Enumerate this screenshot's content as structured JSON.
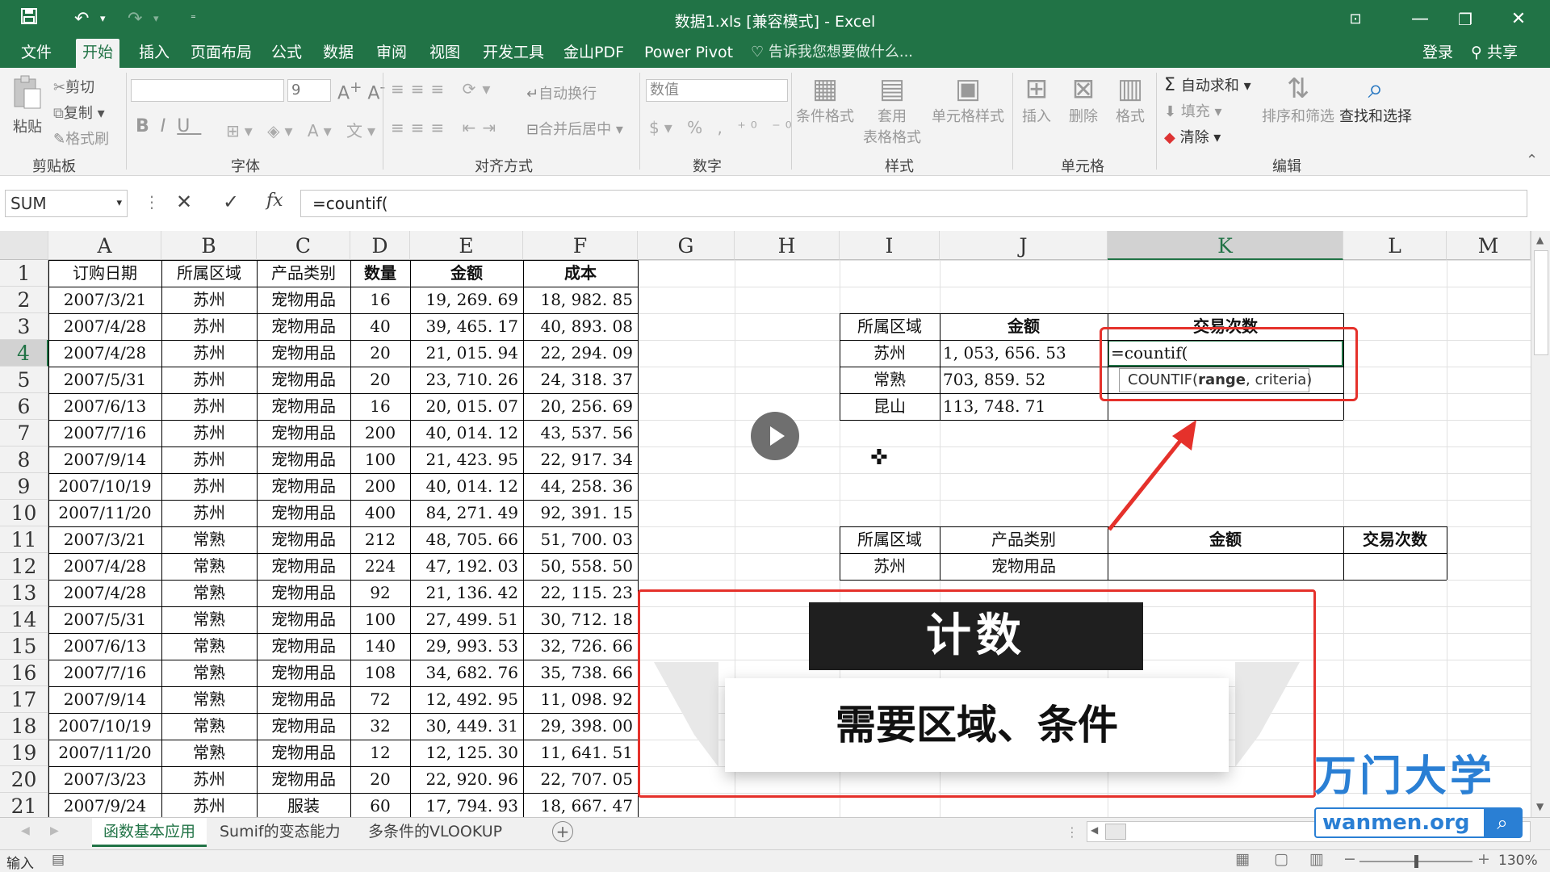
{
  "window": {
    "title": "数据1.xls  [兼容模式] - Excel",
    "quick_access": [
      "save-icon",
      "undo-icon",
      "redo-icon",
      "customize-icon"
    ],
    "controls": [
      "ribbon-display-icon",
      "minimize-icon",
      "restore-icon",
      "close-icon"
    ],
    "accent": "#217346"
  },
  "menu": {
    "tabs": [
      "文件",
      "开始",
      "插入",
      "页面布局",
      "公式",
      "数据",
      "审阅",
      "视图",
      "开发工具",
      "金山PDF",
      "Power Pivot"
    ],
    "active_tab": "开始",
    "tell_me": "告诉我您想要做什么...",
    "login": "登录",
    "share": "共享"
  },
  "ribbon": {
    "clipboard": {
      "paste": "粘贴",
      "cut": "剪切",
      "copy": "复制",
      "format_painter": "格式刷",
      "label": "剪贴板"
    },
    "font": {
      "font_size": "9",
      "label": "字体"
    },
    "alignment": {
      "wrap": "自动换行",
      "merge": "合并后居中",
      "label": "对齐方式"
    },
    "number": {
      "format": "数值",
      "label": "数字"
    },
    "styles": {
      "conditional": "条件格式",
      "table_line1": "套用",
      "table_line2": "表格格式",
      "cell_styles": "单元格样式",
      "label": "样式"
    },
    "cells": {
      "insert": "插入",
      "delete": "删除",
      "format": "格式",
      "label": "单元格"
    },
    "editing": {
      "autosum": "自动求和",
      "fill": "填充",
      "clear": "清除",
      "sort": "排序和筛选",
      "find": "查找和选择",
      "label": "编辑"
    }
  },
  "formula_bar": {
    "name_box": "SUM",
    "formula": "=countif("
  },
  "grid": {
    "columns": [
      "A",
      "B",
      "C",
      "D",
      "E",
      "F",
      "G",
      "H",
      "I",
      "J",
      "K",
      "L",
      "M"
    ],
    "selected_column": "K",
    "selected_row": "4",
    "rows": [
      "1",
      "2",
      "3",
      "4",
      "5",
      "6",
      "7",
      "8",
      "9",
      "10",
      "11",
      "12",
      "13",
      "14",
      "15",
      "16",
      "17",
      "18",
      "19",
      "20",
      "21"
    ]
  },
  "table_main": {
    "headers": [
      "订购日期",
      "所属区域",
      "产品类别",
      "数量",
      "金额",
      "成本"
    ],
    "rows": [
      [
        "2007/3/21",
        "苏州",
        "宠物用品",
        "16",
        "19, 269. 69",
        "18, 982. 85"
      ],
      [
        "2007/4/28",
        "苏州",
        "宠物用品",
        "40",
        "39, 465. 17",
        "40, 893. 08"
      ],
      [
        "2007/4/28",
        "苏州",
        "宠物用品",
        "20",
        "21, 015. 94",
        "22, 294. 09"
      ],
      [
        "2007/5/31",
        "苏州",
        "宠物用品",
        "20",
        "23, 710. 26",
        "24, 318. 37"
      ],
      [
        "2007/6/13",
        "苏州",
        "宠物用品",
        "16",
        "20, 015. 07",
        "20, 256. 69"
      ],
      [
        "2007/7/16",
        "苏州",
        "宠物用品",
        "200",
        "40, 014. 12",
        "43, 537. 56"
      ],
      [
        "2007/9/14",
        "苏州",
        "宠物用品",
        "100",
        "21, 423. 95",
        "22, 917. 34"
      ],
      [
        "2007/10/19",
        "苏州",
        "宠物用品",
        "200",
        "40, 014. 12",
        "44, 258. 36"
      ],
      [
        "2007/11/20",
        "苏州",
        "宠物用品",
        "400",
        "84, 271. 49",
        "92, 391. 15"
      ],
      [
        "2007/3/21",
        "常熟",
        "宠物用品",
        "212",
        "48, 705. 66",
        "51, 700. 03"
      ],
      [
        "2007/4/28",
        "常熟",
        "宠物用品",
        "224",
        "47, 192. 03",
        "50, 558. 50"
      ],
      [
        "2007/4/28",
        "常熟",
        "宠物用品",
        "92",
        "21, 136. 42",
        "22, 115. 23"
      ],
      [
        "2007/5/31",
        "常熟",
        "宠物用品",
        "100",
        "27, 499. 51",
        "30, 712. 18"
      ],
      [
        "2007/6/13",
        "常熟",
        "宠物用品",
        "140",
        "29, 993. 53",
        "32, 726. 66"
      ],
      [
        "2007/7/16",
        "常熟",
        "宠物用品",
        "108",
        "34, 682. 76",
        "35, 738. 66"
      ],
      [
        "2007/9/14",
        "常熟",
        "宠物用品",
        "72",
        "12, 492. 95",
        "11, 098. 92"
      ],
      [
        "2007/10/19",
        "常熟",
        "宠物用品",
        "32",
        "30, 449. 31",
        "29, 398. 00"
      ],
      [
        "2007/11/20",
        "常熟",
        "宠物用品",
        "12",
        "12, 125. 30",
        "11, 641. 51"
      ],
      [
        "2007/3/23",
        "苏州",
        "宠物用品",
        "20",
        "22, 920. 96",
        "22, 707. 05"
      ],
      [
        "2007/9/24",
        "苏州",
        "服装",
        "60",
        "17, 794. 93",
        "18, 667. 47"
      ]
    ]
  },
  "summary1": {
    "headers": [
      "所属区域",
      "金额",
      "交易次数"
    ],
    "rows": [
      [
        "苏州",
        "1, 053, 656. 53",
        "=countif("
      ],
      [
        "常熟",
        "703, 859. 52",
        ""
      ],
      [
        "昆山",
        "113, 748. 71",
        ""
      ]
    ],
    "autocomplete": {
      "fn": "COUNTIF(",
      "arg1": "range",
      "rest": ", criteria)"
    }
  },
  "summary2": {
    "headers": [
      "所属区域",
      "产品类别",
      "金额",
      "交易次数"
    ],
    "row": [
      "苏州",
      "宠物用品",
      "",
      ""
    ]
  },
  "overlay": {
    "title": "计数",
    "subtitle": "需要区域、条件",
    "logo_main": "万门大学",
    "logo_url": "wanmen.org",
    "highlight_color": "#e5312b"
  },
  "sheets": {
    "tabs": [
      "函数基本应用",
      "Sumif的变态能力",
      "多条件的VLOOKUP"
    ],
    "active": "函数基本应用"
  },
  "status": {
    "mode": "输入",
    "zoom": "130%"
  }
}
